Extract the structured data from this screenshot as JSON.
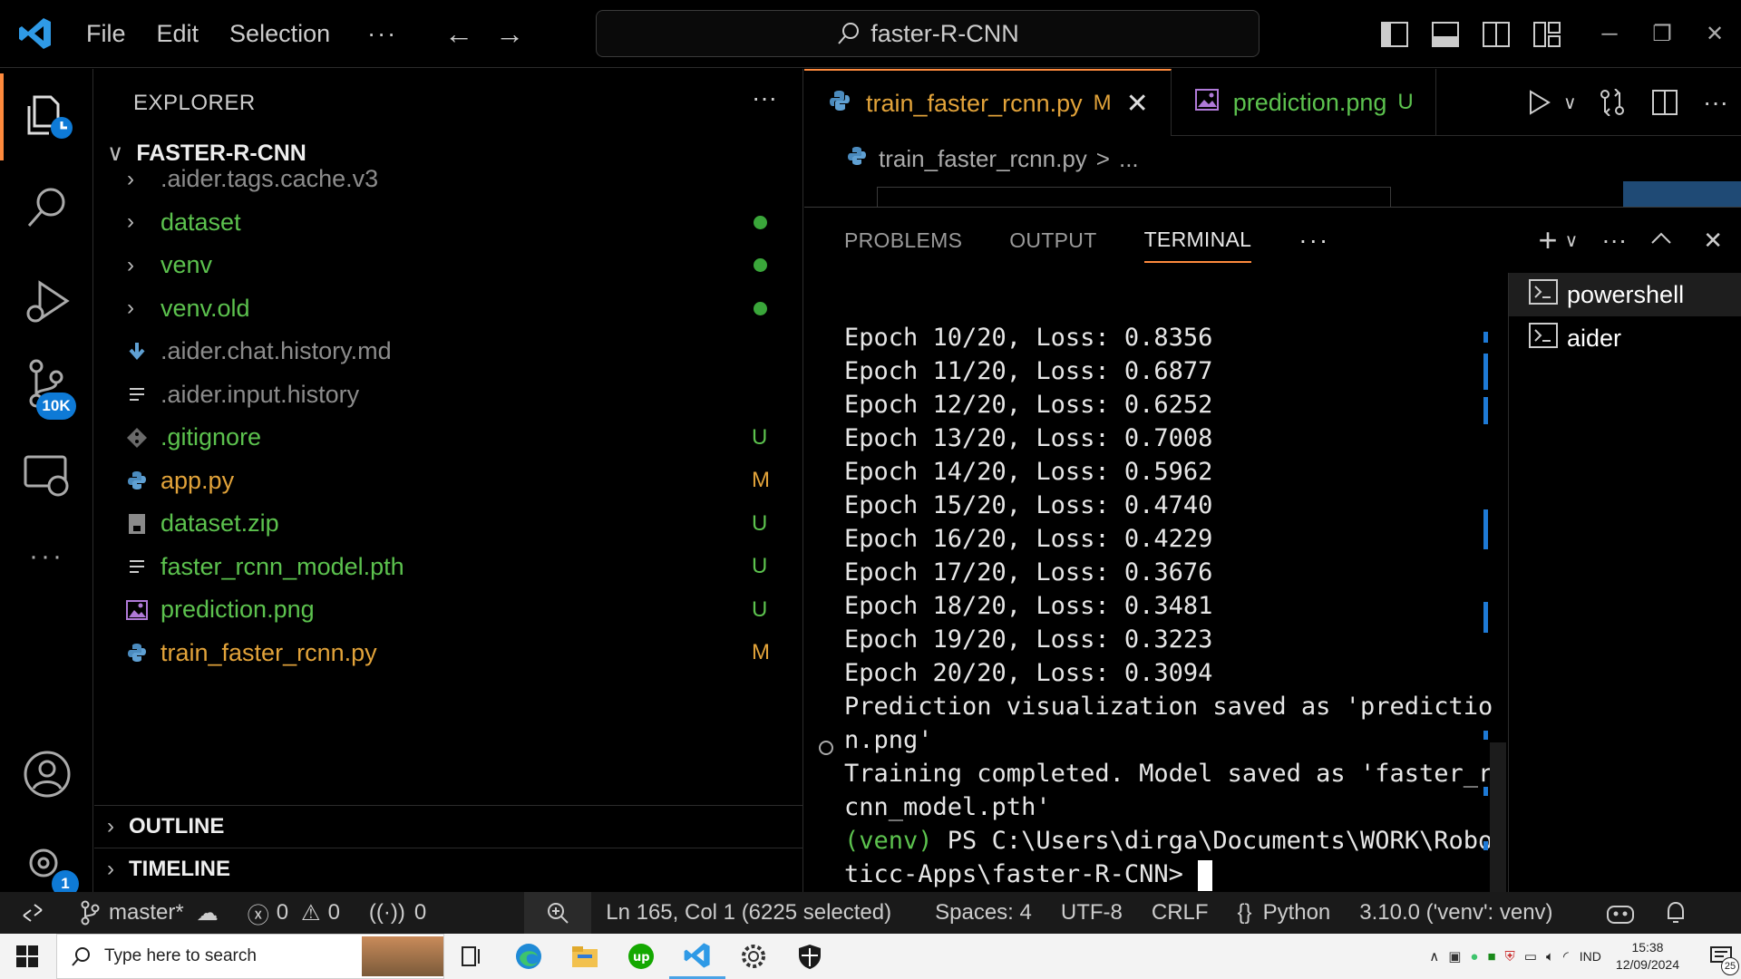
{
  "titlebar": {
    "menu": [
      "File",
      "Edit",
      "Selection"
    ],
    "more": "···",
    "search_text": "faster-R-CNN"
  },
  "activity_bar": {
    "source_control_badge": "10K",
    "accounts_badge": "1"
  },
  "explorer": {
    "header": "EXPLORER",
    "more": "···",
    "folder": "FASTER-R-CNN",
    "items": [
      {
        "name": ".aider.tags.cache.v3",
        "kind": "folder",
        "color": "grey",
        "status": ""
      },
      {
        "name": "dataset",
        "kind": "folder",
        "color": "green",
        "status": "dot"
      },
      {
        "name": "venv",
        "kind": "folder",
        "color": "green",
        "status": "dot"
      },
      {
        "name": "venv.old",
        "kind": "folder",
        "color": "green",
        "status": "dot"
      },
      {
        "name": ".aider.chat.history.md",
        "kind": "md-icon",
        "color": "grey",
        "status": ""
      },
      {
        "name": ".aider.input.history",
        "kind": "lines-icon",
        "color": "grey",
        "status": ""
      },
      {
        "name": ".gitignore",
        "kind": "git-icon",
        "color": "green",
        "status": "U"
      },
      {
        "name": "app.py",
        "kind": "python-icon",
        "color": "orange",
        "status": "M"
      },
      {
        "name": "dataset.zip",
        "kind": "zip-icon",
        "color": "green",
        "status": "U"
      },
      {
        "name": "faster_rcnn_model.pth",
        "kind": "lines-icon",
        "color": "green",
        "status": "U"
      },
      {
        "name": "prediction.png",
        "kind": "image-icon",
        "color": "green",
        "status": "U"
      },
      {
        "name": "train_faster_rcnn.py",
        "kind": "python-icon",
        "color": "orange",
        "status": "M"
      }
    ],
    "outline": "OUTLINE",
    "timeline": "TIMELINE"
  },
  "editor": {
    "tabs": [
      {
        "label": "train_faster_rcnn.py",
        "status": "M",
        "close": "✕"
      },
      {
        "label": "prediction.png",
        "status": "U"
      }
    ],
    "breadcrumb_file": "train_faster_rcnn.py",
    "breadcrumb_sep": ">",
    "breadcrumb_more": "..."
  },
  "panel": {
    "tabs": [
      "PROBLEMS",
      "OUTPUT",
      "TERMINAL"
    ],
    "more": "···",
    "terminal_lines": [
      "Epoch 10/20, Loss: 0.8356",
      "Epoch 11/20, Loss: 0.6877",
      "Epoch 12/20, Loss: 0.6252",
      "Epoch 13/20, Loss: 0.7008",
      "Epoch 14/20, Loss: 0.5962",
      "Epoch 15/20, Loss: 0.4740",
      "Epoch 16/20, Loss: 0.4229",
      "Epoch 17/20, Loss: 0.3676",
      "Epoch 18/20, Loss: 0.3481",
      "Epoch 19/20, Loss: 0.3223",
      "Epoch 20/20, Loss: 0.3094",
      "Prediction visualization saved as 'predictio",
      "n.png'",
      "Training completed. Model saved as 'faster_r",
      "cnn_model.pth'"
    ],
    "prompt_venv": "(venv)",
    "prompt_line1": " PS C:\\Users\\dirga\\Documents\\WORK\\Robo",
    "prompt_line2": "ticc-Apps\\faster-R-CNN> ",
    "terminals": [
      "powershell",
      "aider"
    ]
  },
  "statusbar": {
    "branch": "master*",
    "errors": "0",
    "warnings": "0",
    "ports": "0",
    "position": "Ln 165, Col 1 (6225 selected)",
    "spaces": "Spaces: 4",
    "encoding": "UTF-8",
    "eol": "CRLF",
    "language": "Python",
    "interpreter": "3.10.0 ('venv': venv)"
  },
  "taskbar": {
    "search_placeholder": "Type here to search",
    "language": "IND",
    "time": "15:38",
    "date": "12/09/2024",
    "notif_count": "25"
  },
  "colors": {
    "accent": "#ff8a3d",
    "untracked": "#5cc24e",
    "modified": "#e2a33a",
    "badge": "#0e7ad6"
  }
}
